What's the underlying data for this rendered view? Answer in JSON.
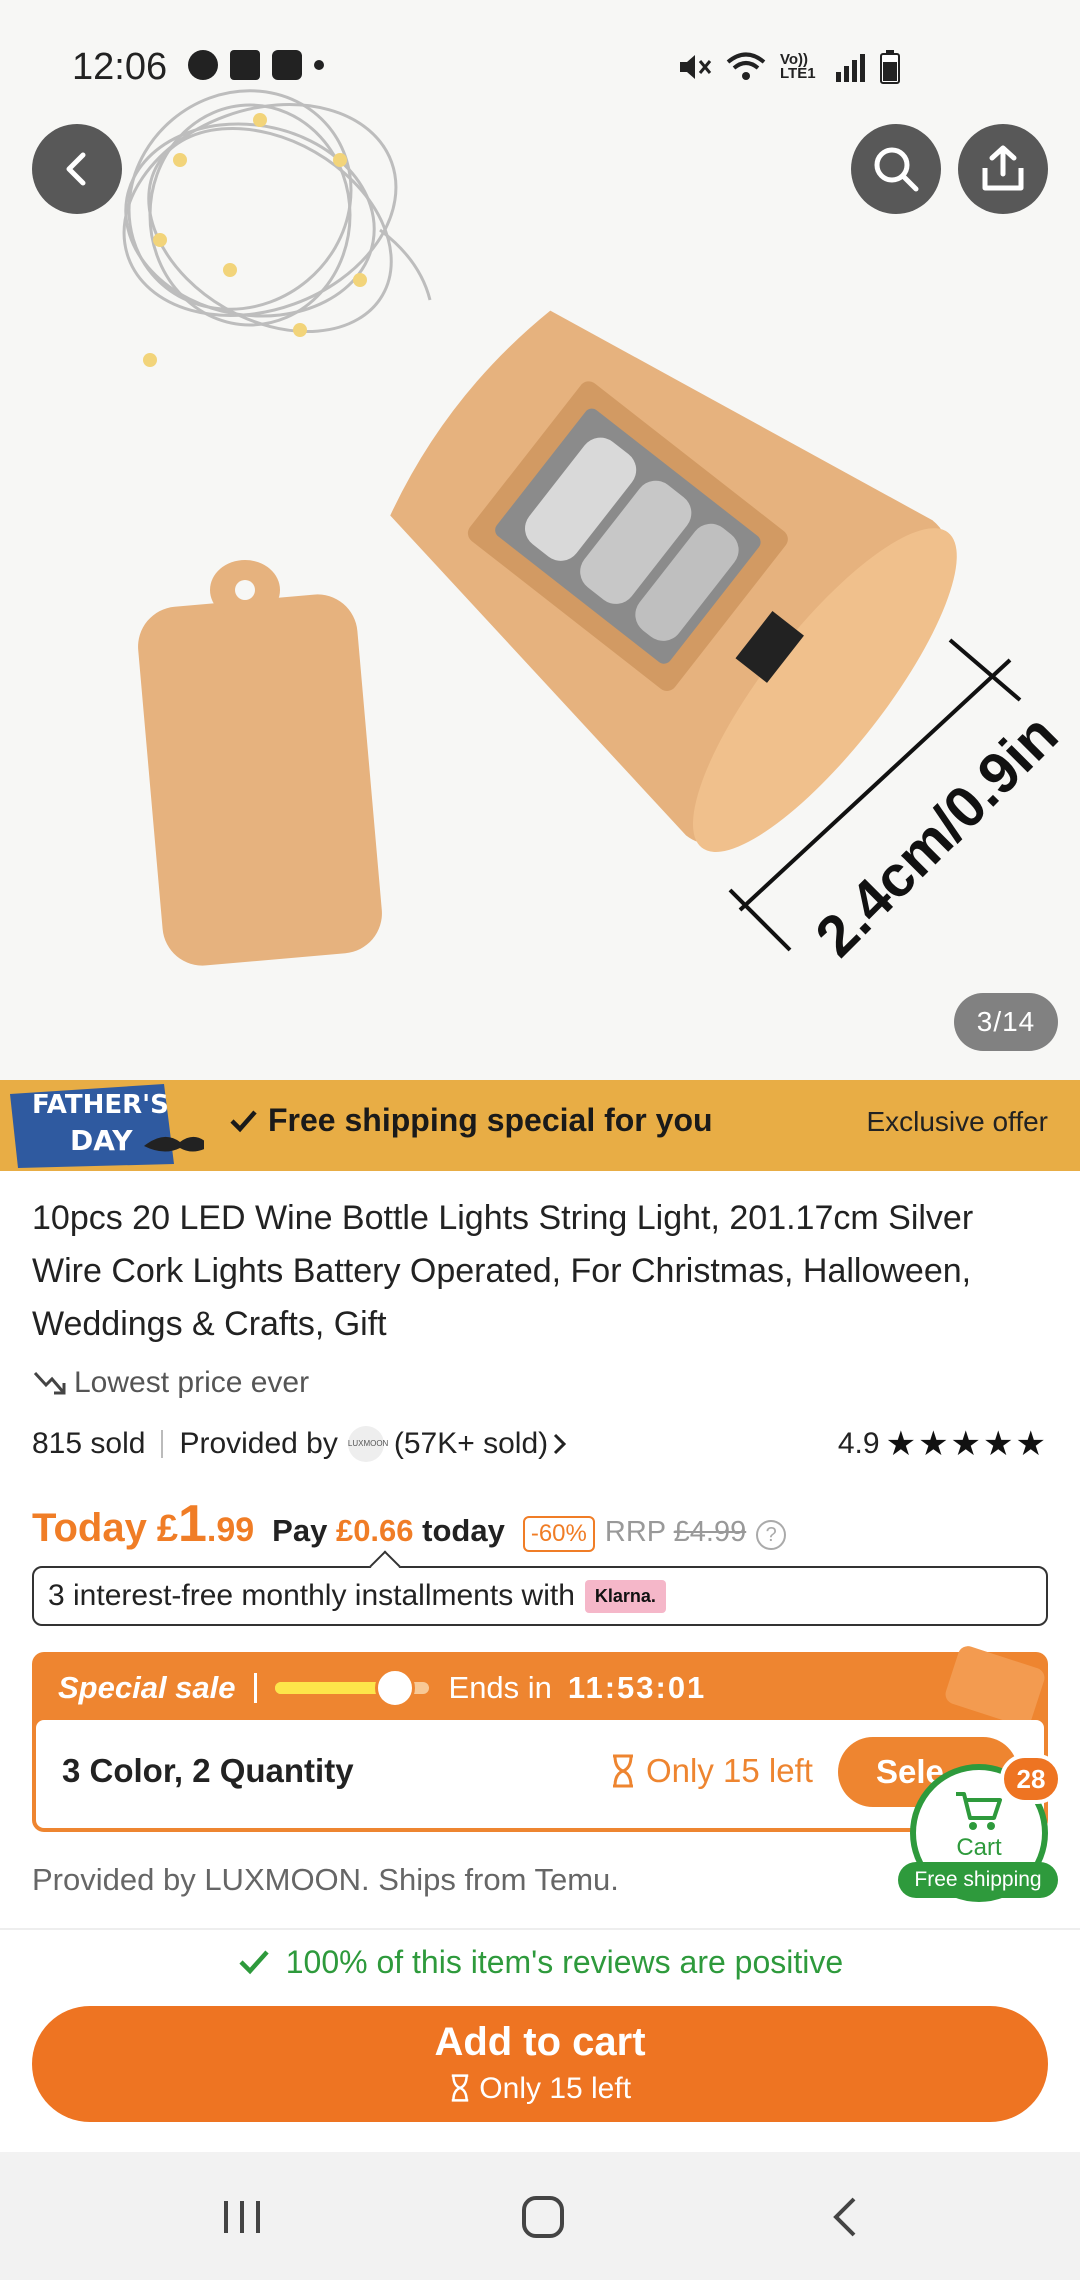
{
  "status_bar": {
    "time": "12:06",
    "icons_left": [
      "wear-icon",
      "trophy-icon",
      "figure-icon",
      "dot-icon"
    ],
    "icons_right": [
      "mute-icon",
      "wifi-icon",
      "volte-icon",
      "signal-icon",
      "battery-icon"
    ],
    "volte_label": "Vo)) LTE1"
  },
  "hero": {
    "dimension_label": "2.4cm/0.9in",
    "counter": "3/14"
  },
  "promo": {
    "badge_line1": "FATHER'S",
    "badge_line2": "DAY",
    "free_shipping": "Free shipping special for you",
    "exclusive": "Exclusive offer",
    "bg_color": "#e8ad45"
  },
  "product": {
    "title": "10pcs 20 LED Wine Bottle Lights String Light, 201.17cm Silver Wire Cork Lights Battery Operated, For Christmas, Halloween, Weddings & Crafts, Gift",
    "lowest_price": "Lowest price ever",
    "sold": "815 sold",
    "provided_by": "Provided by",
    "store_logo_text": "LUXMOON",
    "store_sold": "(57K+ sold)",
    "rating": "4.9",
    "stars": "★★★★★"
  },
  "price": {
    "today_label": "Today",
    "currency": "£",
    "whole": "1",
    "fraction": ".99",
    "pay_label": "Pay",
    "pay_amount": "£0.66",
    "pay_suffix": "today",
    "discount": "-60%",
    "rrp_label": "RRP",
    "rrp_value": "£4.99",
    "accent_color": "#f07d26"
  },
  "klarna": {
    "text": "3 interest-free monthly installments with",
    "logo": "Klarna."
  },
  "sale": {
    "label": "Special sale",
    "progress": 0.78,
    "ends_label": "Ends in",
    "timer": "11:53:01",
    "variant": "3 Color, 2 Quantity",
    "stock": "Only 15 left",
    "select_label": "Sele"
  },
  "cart": {
    "label": "Cart",
    "count": "28",
    "free_shipping": "Free shipping",
    "color": "#2e9a3c"
  },
  "shipping_note": "Provided by LUXMOON. Ships from Temu.",
  "reviews": {
    "text": "100% of this item's reviews are positive"
  },
  "add_to_cart": {
    "label": "Add to cart",
    "stock": "Only 15 left",
    "color": "#ee7422"
  },
  "nav": {
    "items": [
      "recent-apps",
      "home",
      "back"
    ]
  }
}
